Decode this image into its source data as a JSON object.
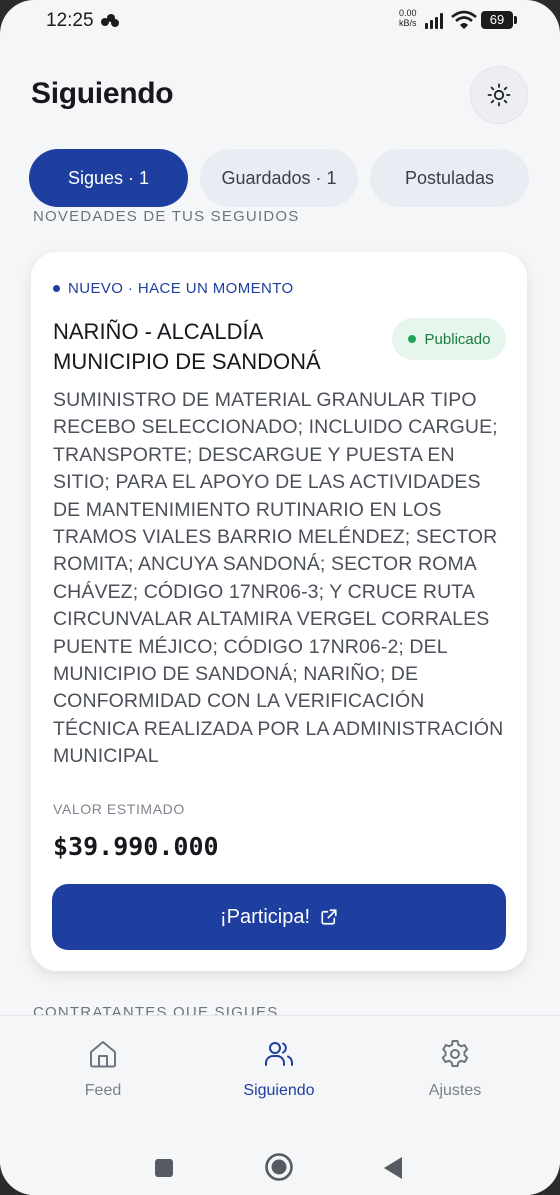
{
  "status_bar": {
    "time": "12:25",
    "net_speed_value": "0.00",
    "net_speed_unit": "kB/s",
    "battery": "69"
  },
  "header": {
    "title": "Siguiendo",
    "theme_icon": "sun-icon"
  },
  "tabs": [
    {
      "label": "Sigues · 1",
      "active": true
    },
    {
      "label": "Guardados · 1",
      "active": false
    },
    {
      "label": "Postuladas",
      "active": false
    }
  ],
  "sections": {
    "updates_label": "NOVEDADES DE TUS SEGUIDOS",
    "contractors_label": "CONTRATANTES QUE SIGUES"
  },
  "card": {
    "meta": "NUEVO · HACE UN MOMENTO",
    "entity_line1": "NARIÑO - ALCALDÍA",
    "entity_line2": "MUNICIPIO DE SANDONÁ",
    "status": "Publicado",
    "description": "SUMINISTRO DE MATERIAL GRANULAR TIPO RECEBO SELECCIONADO; INCLUIDO CARGUE; TRANSPORTE; DESCARGUE Y PUESTA EN SITIO; PARA EL APOYO DE LAS ACTIVIDADES DE MANTENIMIENTO RUTINARIO EN LOS TRAMOS VIALES BARRIO MELÉNDEZ; SECTOR ROMITA; ANCUYA  SANDONÁ; SECTOR ROMA CHÁVEZ; CÓDIGO 17NR06-3; Y CRUCE RUTA CIRCUNVALAR  ALTAMIRA  VERGEL CORRALES  PUENTE MÉJICO; CÓDIGO 17NR06-2; DEL MUNICIPIO DE SANDONÁ; NARIÑO; DE CONFORMIDAD CON LA VERIFICACIÓN TÉCNICA REALIZADA POR LA ADMINISTRACIÓN MUNICIPAL",
    "value_label": "VALOR ESTIMADO",
    "value": "$39.990.000",
    "cta_label": "¡Participa!",
    "cta_icon": "external-link-icon"
  },
  "bottom_nav": [
    {
      "label": "Feed",
      "icon": "home-icon",
      "active": false
    },
    {
      "label": "Siguiendo",
      "icon": "users-icon",
      "active": true
    },
    {
      "label": "Ajustes",
      "icon": "gear-icon",
      "active": false
    }
  ],
  "colors": {
    "accent": "#1e3fa0",
    "success": "#22a35a",
    "background": "#f5f6f8"
  }
}
